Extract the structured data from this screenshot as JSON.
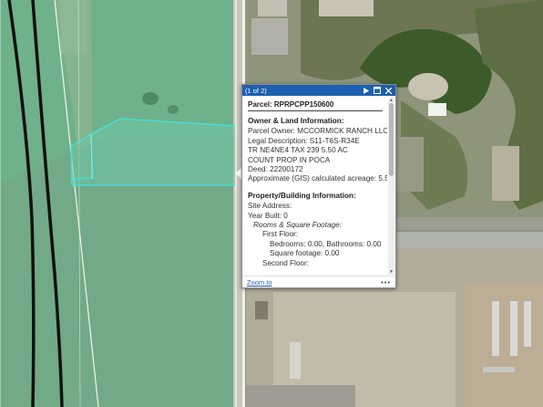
{
  "popup": {
    "counter": "(1 of 2)",
    "title": "Parcel: RPRPCPP150600",
    "section_owner": "Owner & Land Information:",
    "owner": "Parcel Owner: MCCORMICK RANCH LLC",
    "legal": "Legal Description: S11-T6S-R34E",
    "legal2": "TR NE4NE4 TAX 239 5.50 AC",
    "legal3": "COUNT PROP IN POCA",
    "deed": "Deed: 22200172",
    "acreage": "Approximate (GIS) calculated acreage: 5.50",
    "section_building": "Property/Building Information:",
    "site_address": "Site Address:",
    "year_built": "Year Built: 0",
    "rooms_label": "Rooms & Square Footage:",
    "first_floor": "First Floor:",
    "bed_bath": "Bedrooms: 0.00, Bathrooms: 0.00",
    "sqft": "Square footage: 0.00",
    "second_floor": "Second Floor:",
    "zoom_to": "Zoom to",
    "more": "•••"
  },
  "icons": {
    "next": "play-icon",
    "dock": "dock-icon",
    "close": "close-icon"
  },
  "colors": {
    "header": "#1d5fb0",
    "parcel_outline": "#3fe3e0",
    "highlight_fill": "#4fbf8f"
  }
}
